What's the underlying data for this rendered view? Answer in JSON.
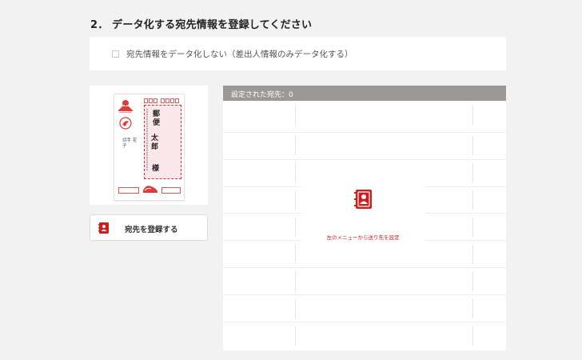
{
  "section": {
    "title": "2． データ化する宛先情報を登録してください"
  },
  "option": {
    "checkbox_checked": false,
    "label": "宛先情報をデータ化しない（差出人情報のみデータ化する）"
  },
  "postcard_preview": {
    "recipient_name_line1": "郵便",
    "recipient_name_line2": "太郎",
    "recipient_honorific": "様",
    "sender_name": "切手 花子"
  },
  "register_button": {
    "label": "宛先を登録する",
    "icon": "address-book-icon"
  },
  "recipients_table": {
    "header": "設定された宛先：0",
    "empty_message": "左のメニューから送り先を設定",
    "empty_icon": "address-book-icon"
  },
  "colors": {
    "accent_red": "#d21b1b",
    "header_gray": "#9b9896",
    "page_background": "#f2f2f2"
  }
}
